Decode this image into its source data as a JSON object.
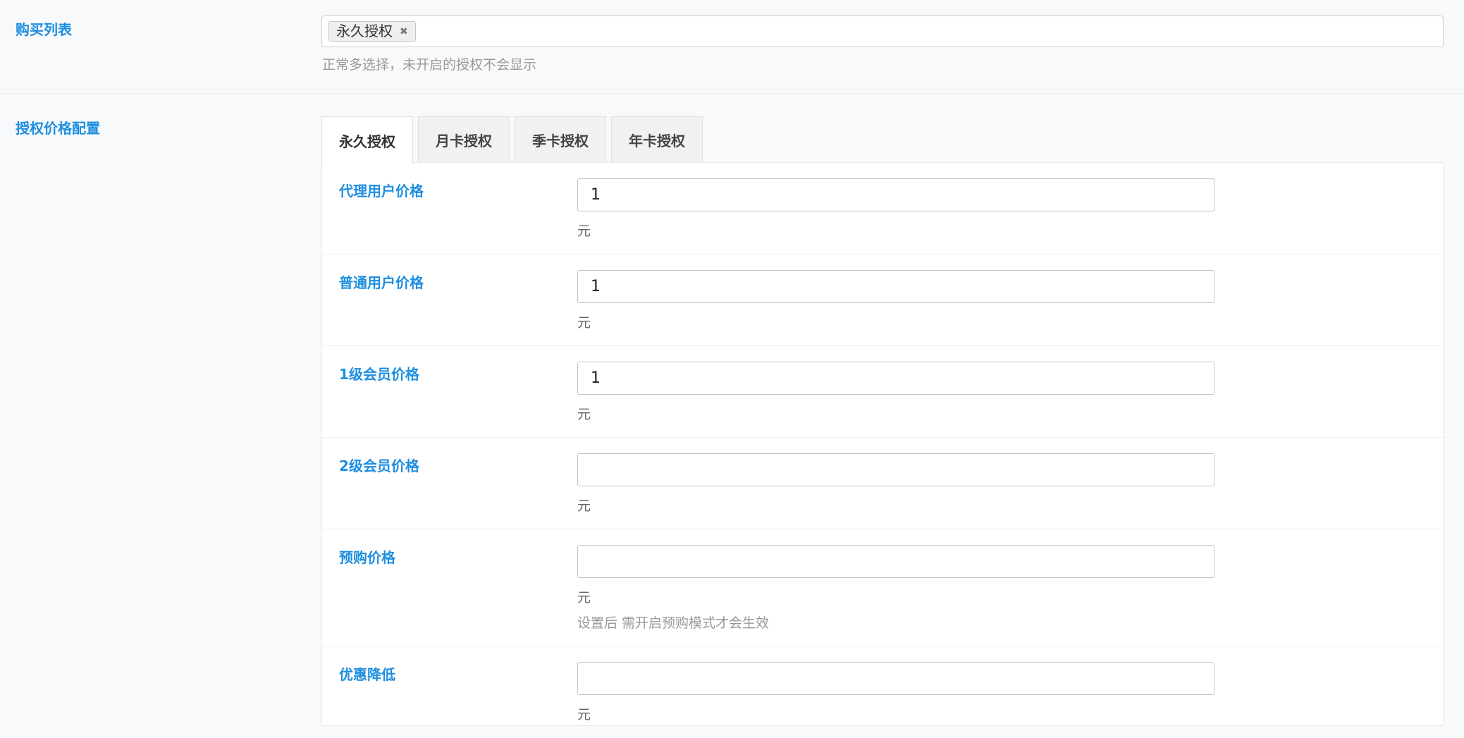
{
  "purchase": {
    "label": "购买列表",
    "selected_tags": [
      {
        "label": "永久授权",
        "close": "✖"
      }
    ],
    "hint": "正常多选择，未开启的授权不会显示"
  },
  "pricing": {
    "label": "授权价格配置",
    "tabs": [
      {
        "label": "永久授权",
        "active": true
      },
      {
        "label": "月卡授权",
        "active": false
      },
      {
        "label": "季卡授权",
        "active": false
      },
      {
        "label": "年卡授权",
        "active": false
      }
    ],
    "fields": [
      {
        "label": "代理用户价格",
        "value": "1",
        "unit": "元",
        "note": ""
      },
      {
        "label": "普通用户价格",
        "value": "1",
        "unit": "元",
        "note": ""
      },
      {
        "label": "1级会员价格",
        "value": "1",
        "unit": "元",
        "note": ""
      },
      {
        "label": "2级会员价格",
        "value": "",
        "unit": "元",
        "note": ""
      },
      {
        "label": "预购价格",
        "value": "",
        "unit": "元",
        "note": "设置后 需开启预购模式才会生效"
      },
      {
        "label": "优惠降低",
        "value": "",
        "unit": "元",
        "note": ""
      }
    ]
  },
  "colors": {
    "accent": "#1e8fe1",
    "background": "#f8f9fa",
    "hint": "#999999"
  }
}
